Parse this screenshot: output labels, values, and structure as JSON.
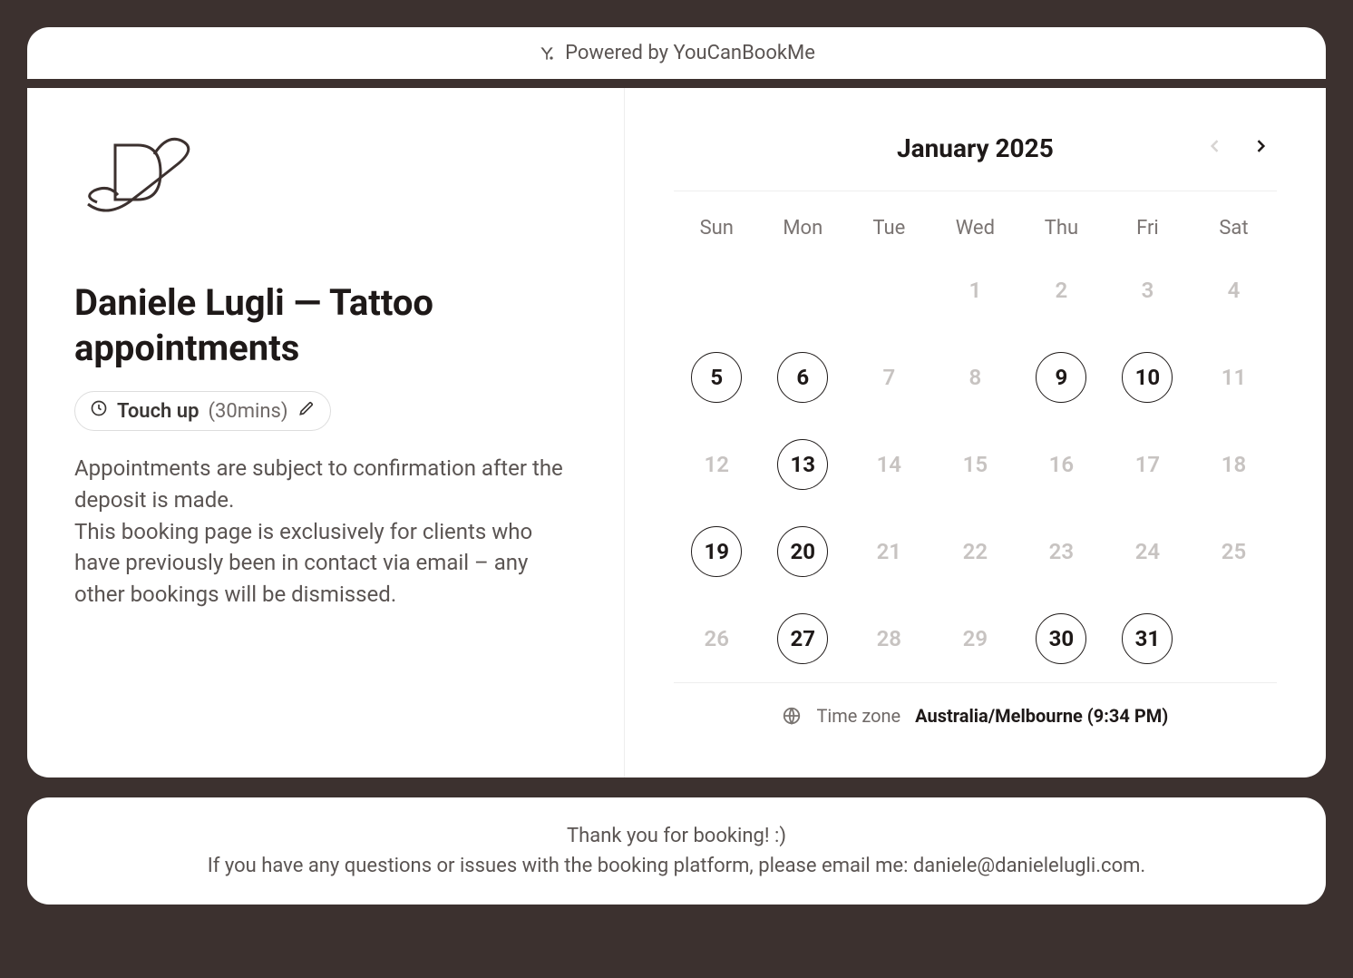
{
  "powered": {
    "label": "Powered by YouCanBookMe"
  },
  "header": {
    "title": "Daniele Lugli — Tattoo appointments",
    "service": {
      "name": "Touch up",
      "duration": "(30mins)"
    },
    "description_line1": "Appointments are subject to confirmation after the deposit is made.",
    "description_line2": "This booking page is exclusively for clients who have previously been in contact via email – any other bookings will be dismissed."
  },
  "calendar": {
    "month_label": "January 2025",
    "weekdays": [
      "Sun",
      "Mon",
      "Tue",
      "Wed",
      "Thu",
      "Fri",
      "Sat"
    ],
    "days": [
      {
        "label": "",
        "available": false
      },
      {
        "label": "",
        "available": false
      },
      {
        "label": "",
        "available": false
      },
      {
        "label": "1",
        "available": false
      },
      {
        "label": "2",
        "available": false
      },
      {
        "label": "3",
        "available": false
      },
      {
        "label": "4",
        "available": false
      },
      {
        "label": "5",
        "available": true
      },
      {
        "label": "6",
        "available": true
      },
      {
        "label": "7",
        "available": false
      },
      {
        "label": "8",
        "available": false
      },
      {
        "label": "9",
        "available": true
      },
      {
        "label": "10",
        "available": true
      },
      {
        "label": "11",
        "available": false
      },
      {
        "label": "12",
        "available": false
      },
      {
        "label": "13",
        "available": true
      },
      {
        "label": "14",
        "available": false
      },
      {
        "label": "15",
        "available": false
      },
      {
        "label": "16",
        "available": false
      },
      {
        "label": "17",
        "available": false
      },
      {
        "label": "18",
        "available": false
      },
      {
        "label": "19",
        "available": true
      },
      {
        "label": "20",
        "available": true
      },
      {
        "label": "21",
        "available": false
      },
      {
        "label": "22",
        "available": false
      },
      {
        "label": "23",
        "available": false
      },
      {
        "label": "24",
        "available": false
      },
      {
        "label": "25",
        "available": false
      },
      {
        "label": "26",
        "available": false
      },
      {
        "label": "27",
        "available": true
      },
      {
        "label": "28",
        "available": false
      },
      {
        "label": "29",
        "available": false
      },
      {
        "label": "30",
        "available": true
      },
      {
        "label": "31",
        "available": true
      },
      {
        "label": "",
        "available": false
      }
    ],
    "timezone_label": "Time zone",
    "timezone_value": "Australia/Melbourne (9:34 PM)"
  },
  "footer": {
    "line1": "Thank you for booking! :)",
    "line2": "If you have any questions or issues with the booking platform, please email me: daniele@danielelugli.com."
  }
}
